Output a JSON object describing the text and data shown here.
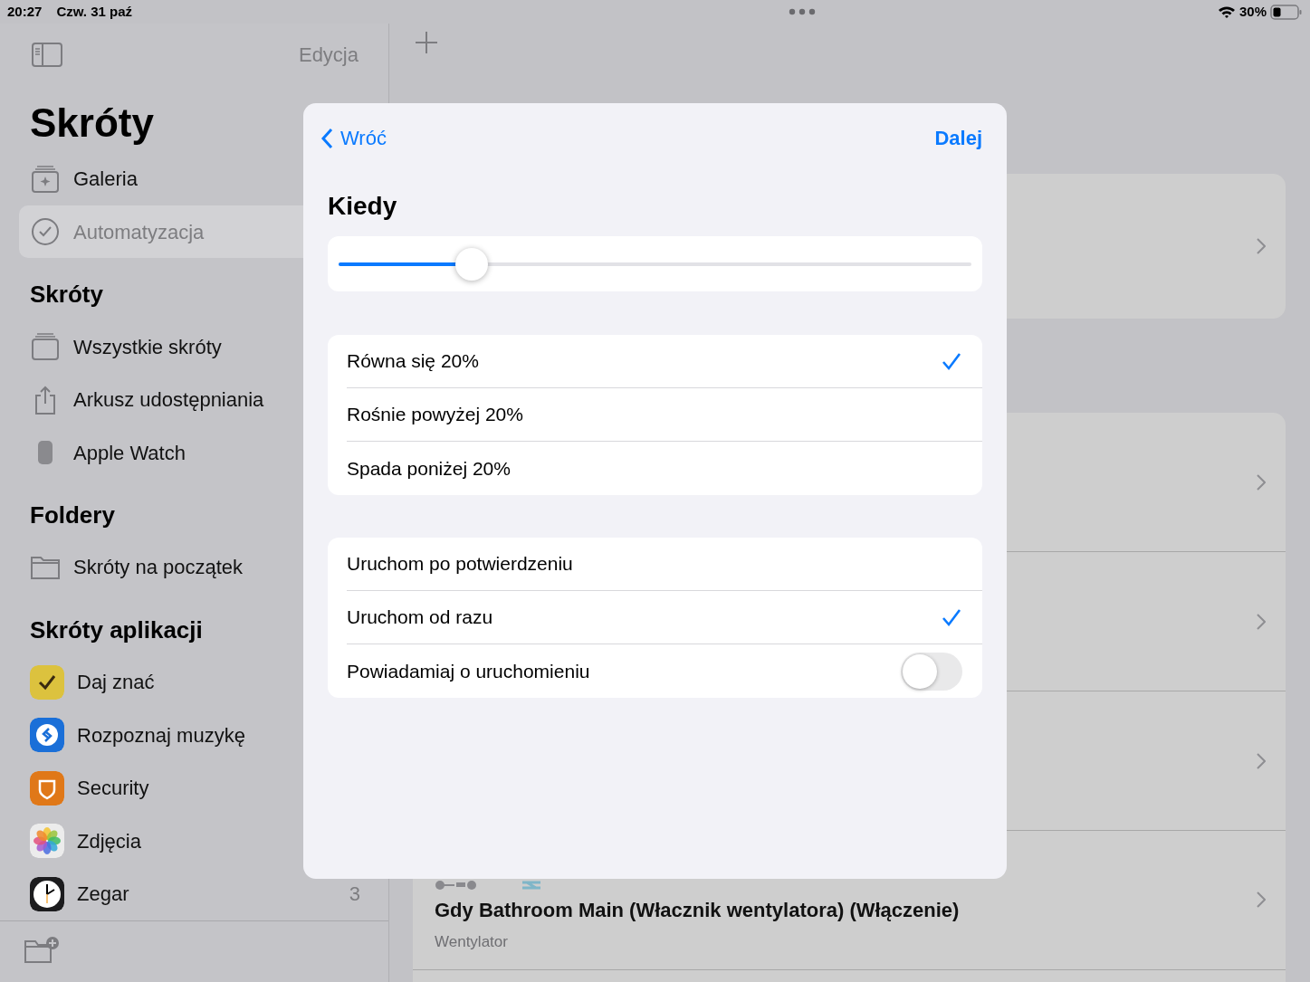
{
  "status_bar": {
    "time": "20:27",
    "date": "Czw. 31 paź",
    "battery": "30%"
  },
  "sidebar": {
    "edit_button": "Edycja",
    "title": "Skróty",
    "top_items": [
      {
        "kind": "gallery",
        "label": "Galeria",
        "selected": false
      },
      {
        "kind": "automation",
        "label": "Automatyzacja",
        "selected": true
      }
    ],
    "sections": [
      {
        "heading": "Skróty",
        "items": [
          {
            "kind": "stack",
            "label": "Wszystkie skróty"
          },
          {
            "kind": "share",
            "label": "Arkusz udostępniania"
          },
          {
            "kind": "watch",
            "label": "Apple Watch"
          }
        ]
      },
      {
        "heading": "Foldery",
        "items": [
          {
            "kind": "folder",
            "label": "Skróty na początek"
          }
        ]
      },
      {
        "heading": "Skróty aplikacji",
        "items": [
          {
            "kind": "reminders",
            "label": "Daj znać"
          },
          {
            "kind": "shazam",
            "label": "Rozpoznaj muzykę"
          },
          {
            "kind": "shield",
            "label": "Security"
          },
          {
            "kind": "photos",
            "label": "Zdjęcia"
          },
          {
            "kind": "clock",
            "label": "Zegar",
            "count": "3"
          }
        ]
      }
    ]
  },
  "automation_list": {
    "visible_row": {
      "title": "Gdy Bathroom Main (Włacznik wentylatora) (Włączenie)",
      "subtitle": "Wentylator"
    }
  },
  "dialog": {
    "back_button": "Wróć",
    "next_button": "Dalej",
    "heading": "Kiedy",
    "slider": {
      "level": 0.21
    },
    "conditions": [
      {
        "label": "Równa się 20%",
        "selected": true
      },
      {
        "label": "Rośnie powyżej 20%",
        "selected": false
      },
      {
        "label": "Spada poniżej 20%",
        "selected": false
      }
    ],
    "run_options": [
      {
        "kind": "choice",
        "label": "Uruchom po potwierdzeniu",
        "selected": false
      },
      {
        "kind": "choice",
        "label": "Uruchom od razu",
        "selected": true
      },
      {
        "kind": "toggle",
        "label": "Powiadamiaj o uruchomieniu",
        "on": false
      }
    ]
  }
}
